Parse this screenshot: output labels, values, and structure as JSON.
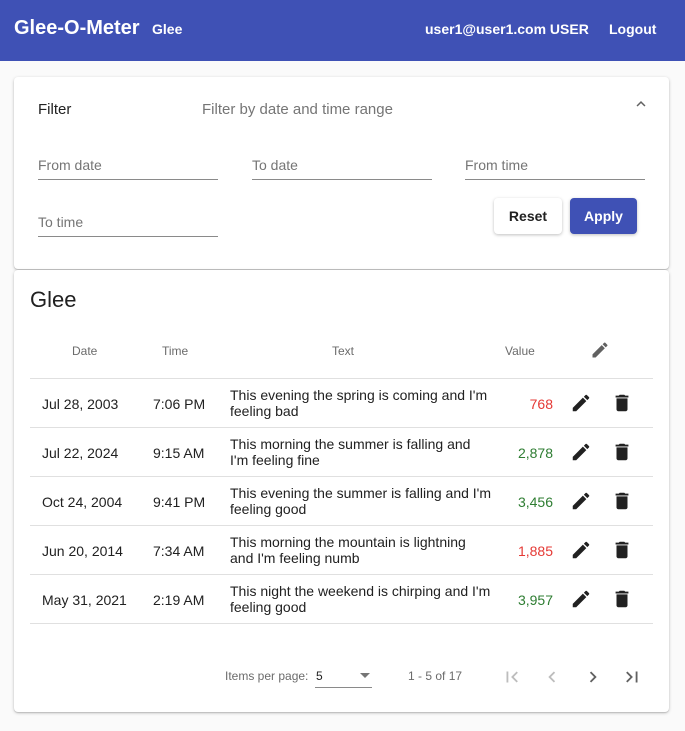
{
  "header": {
    "app_title": "Glee-O-Meter",
    "nav_link": "Glee",
    "user": "user1@user1.com USER",
    "logout": "Logout"
  },
  "filter": {
    "title": "Filter",
    "description": "Filter by date and time range",
    "from_date_label": "From date",
    "to_date_label": "To date",
    "from_time_label": "From time",
    "to_time_label": "To time",
    "reset_label": "Reset",
    "apply_label": "Apply"
  },
  "glee": {
    "title": "Glee",
    "columns": {
      "date": "Date",
      "time": "Time",
      "text": "Text",
      "value": "Value"
    },
    "rows": [
      {
        "date": "Jul 28, 2003",
        "time": "7:06 PM",
        "text": "This evening the spring is coming and I'm feeling bad",
        "value": "768",
        "value_color": "#e53935"
      },
      {
        "date": "Jul 22, 2024",
        "time": "9:15 AM",
        "text": "This morning the summer is falling and I'm feeling fine",
        "value": "2,878",
        "value_color": "#2e7d32"
      },
      {
        "date": "Oct 24, 2004",
        "time": "9:41 PM",
        "text": "This evening the summer is falling and I'm feeling good",
        "value": "3,456",
        "value_color": "#2e7d32"
      },
      {
        "date": "Jun 20, 2014",
        "time": "7:34 AM",
        "text": "This morning the mountain is lightning and I'm feeling numb",
        "value": "1,885",
        "value_color": "#e53935"
      },
      {
        "date": "May 31, 2021",
        "time": "2:19 AM",
        "text": "This night the weekend is chirping and I'm feeling good",
        "value": "3,957",
        "value_color": "#2e7d32"
      }
    ],
    "paginator": {
      "items_per_page_label": "Items per page:",
      "page_size": "5",
      "range_label": "1 - 5 of 17"
    }
  },
  "colors": {
    "primary": "#3f51b5",
    "positive": "#2e7d32",
    "negative": "#e53935"
  },
  "icons": [
    "chevron-up-icon",
    "pencil-icon",
    "trash-icon",
    "first-page-icon",
    "chevron-left-icon",
    "chevron-right-icon",
    "last-page-icon",
    "dropdown-arrow-icon"
  ]
}
